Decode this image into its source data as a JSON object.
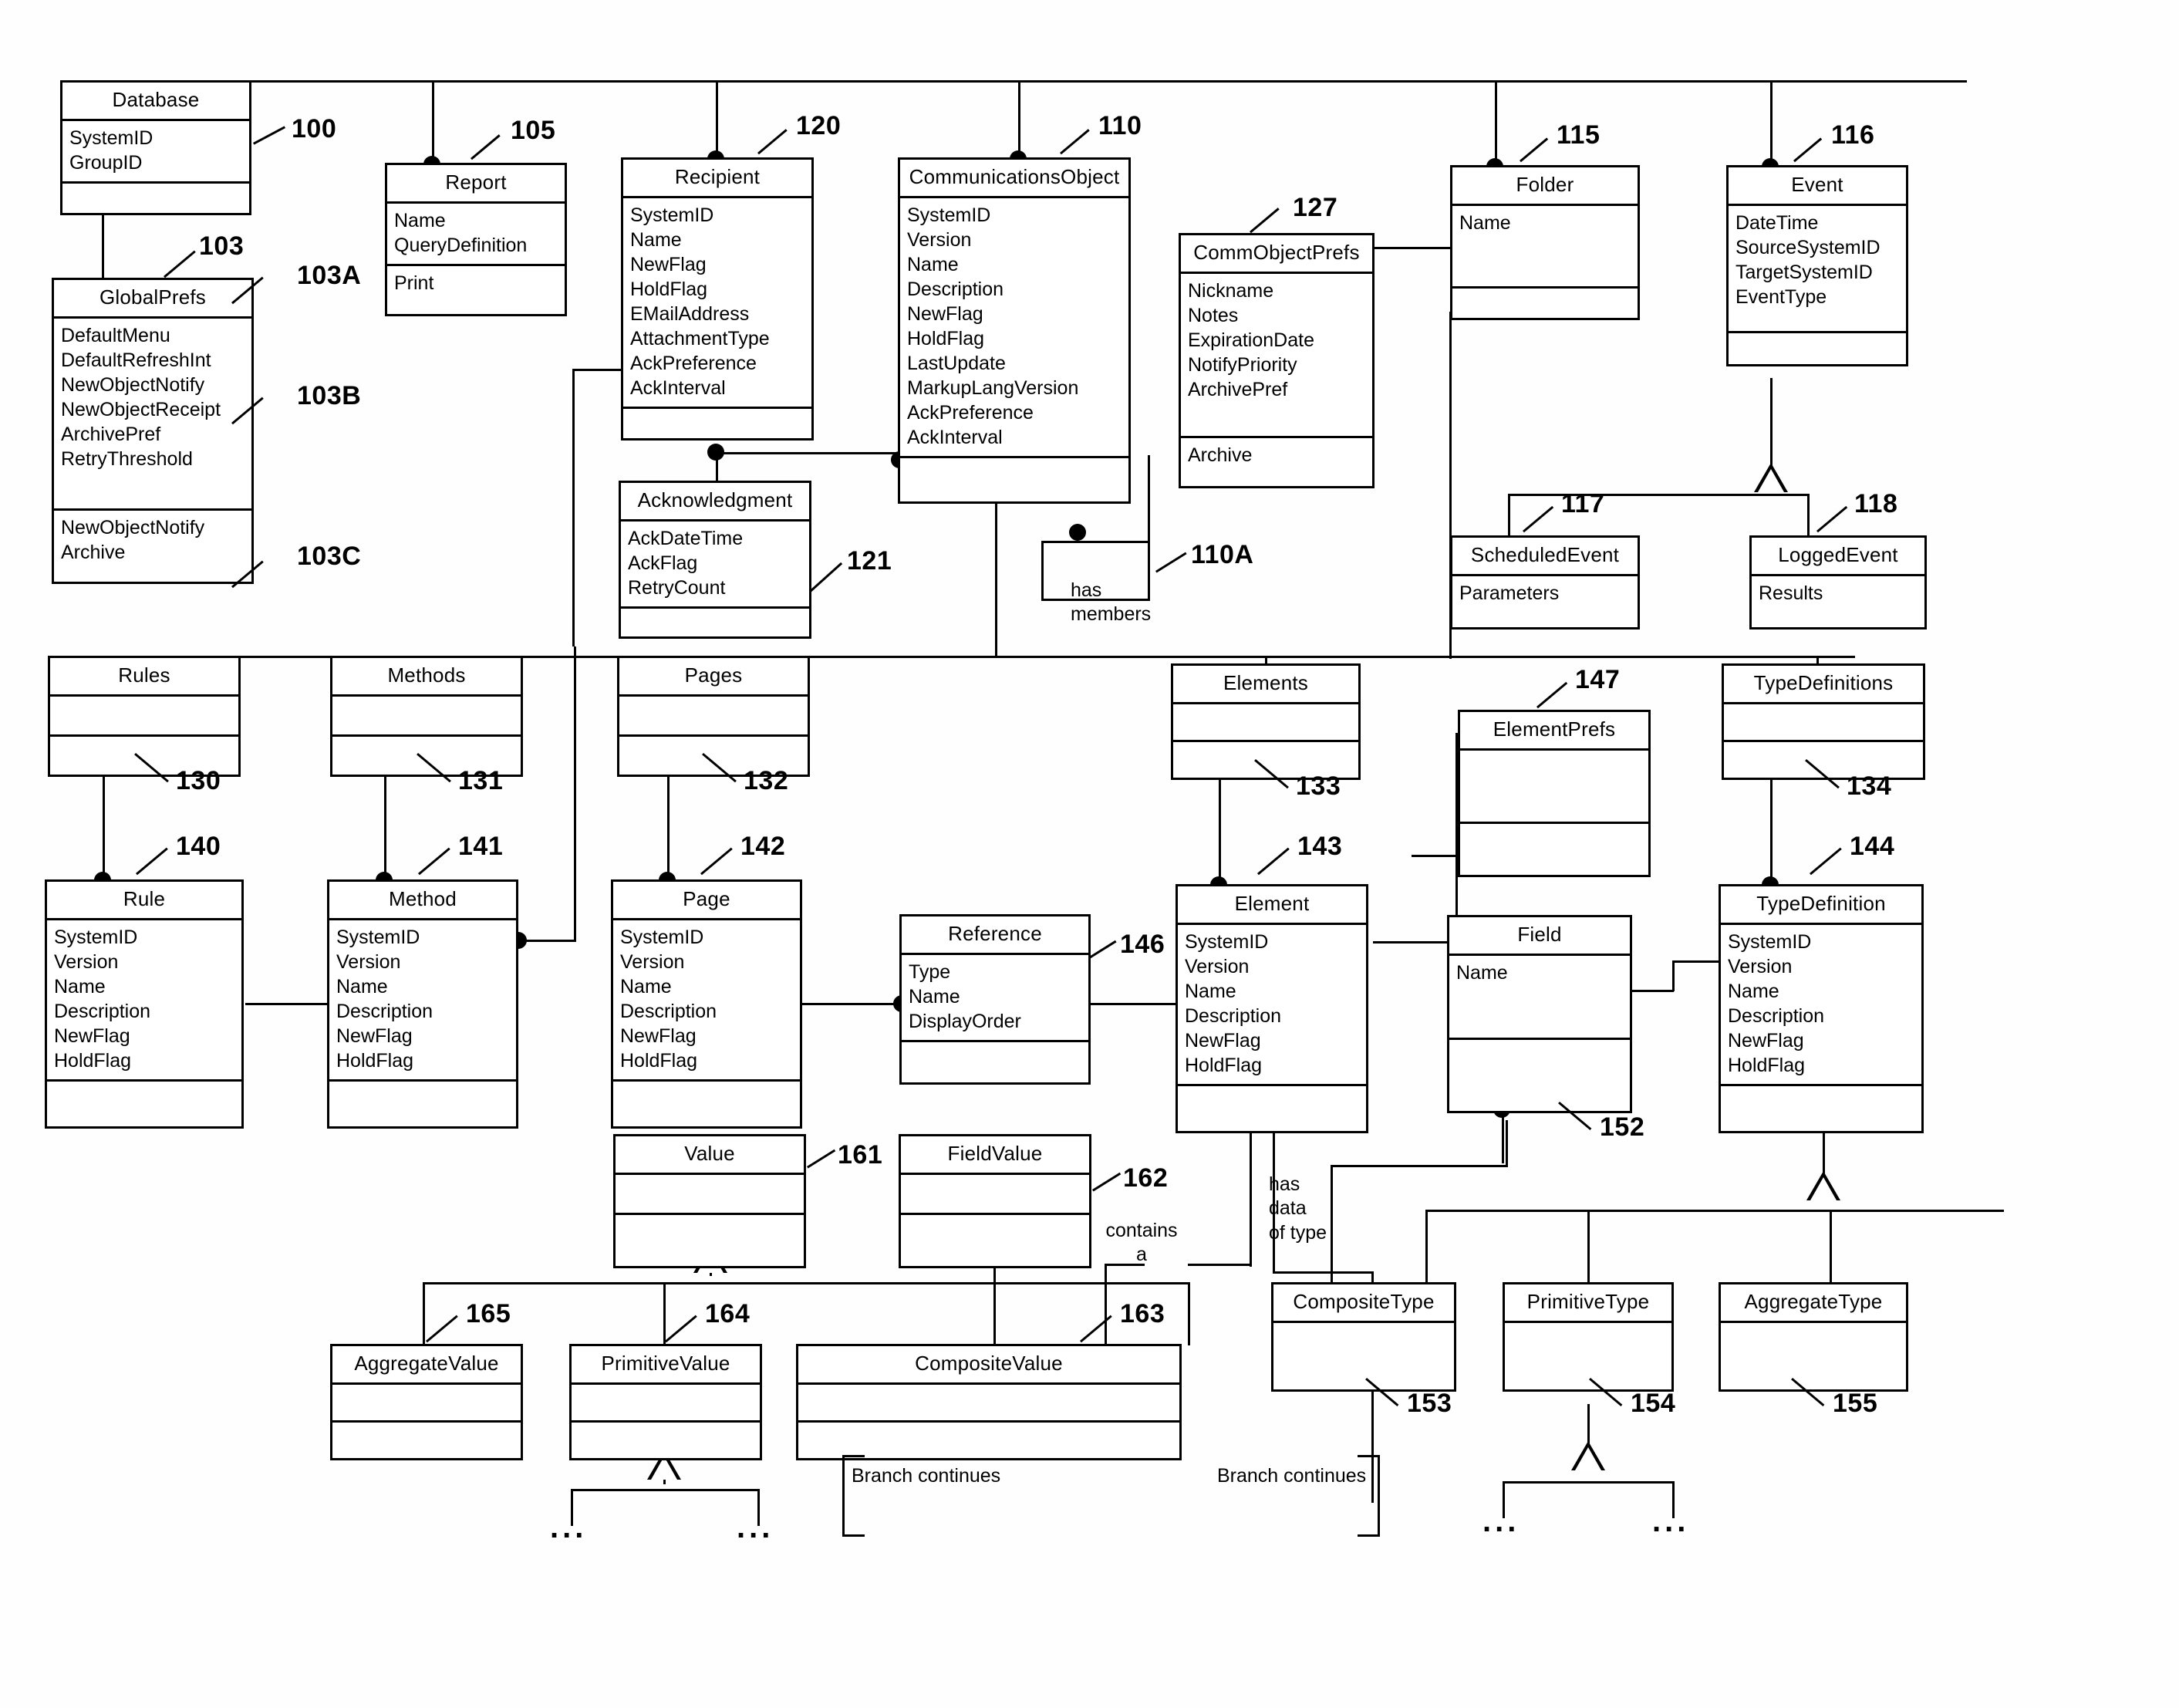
{
  "figure": {
    "type": "uml-class-diagram",
    "classes": [
      {
        "id": "database",
        "name": "Database",
        "ref": "100",
        "attrs": [
          "SystemID",
          "GroupID"
        ],
        "ops": []
      },
      {
        "id": "globalprefs",
        "name": "GlobalPrefs",
        "ref": "103",
        "ref_a": "103A",
        "ref_b": "103B",
        "ref_c": "103C",
        "attrs": [
          "DefaultMenu",
          "DefaultRefreshInt",
          "NewObjectNotify",
          "NewObjectReceipt",
          "ArchivePref",
          "RetryThreshold"
        ],
        "ops": [
          "NewObjectNotify",
          "Archive"
        ]
      },
      {
        "id": "report",
        "name": "Report",
        "ref": "105",
        "attrs": [
          "Name",
          "QueryDefinition"
        ],
        "ops": [
          "Print"
        ]
      },
      {
        "id": "recipient",
        "name": "Recipient",
        "ref": "120",
        "attrs": [
          "SystemID",
          "Name",
          "NewFlag",
          "HoldFlag",
          "EMailAddress",
          "AttachmentType",
          "AckPreference",
          "AckInterval"
        ],
        "ops": []
      },
      {
        "id": "communicationsobject",
        "name": "CommunicationsObject",
        "ref": "110",
        "ref_a": "110A",
        "attrs": [
          "SystemID",
          "Version",
          "Name",
          "Description",
          "NewFlag",
          "HoldFlag",
          "LastUpdate",
          "MarkupLangVersion",
          "AckPreference",
          "AckInterval"
        ],
        "ops": []
      },
      {
        "id": "commobjectprefs",
        "name": "CommObjectPrefs",
        "ref": "127",
        "attrs": [
          "Nickname",
          "Notes",
          "ExpirationDate",
          "NotifyPriority",
          "ArchivePref"
        ],
        "ops": [
          "Archive"
        ]
      },
      {
        "id": "folder",
        "name": "Folder",
        "ref": "115",
        "attrs": [
          "Name"
        ],
        "ops": []
      },
      {
        "id": "event",
        "name": "Event",
        "ref": "116",
        "attrs": [
          "DateTime",
          "SourceSystemID",
          "TargetSystemID",
          "EventType"
        ],
        "ops": []
      },
      {
        "id": "scheduledevent",
        "name": "ScheduledEvent",
        "ref": "117",
        "attrs": [
          "Parameters"
        ],
        "ops": []
      },
      {
        "id": "loggedevent",
        "name": "LoggedEvent",
        "ref": "118",
        "attrs": [
          "Results"
        ],
        "ops": []
      },
      {
        "id": "acknowledgment",
        "name": "Acknowledgment",
        "ref": "121",
        "attrs": [
          "AckDateTime",
          "AckFlag",
          "RetryCount"
        ],
        "ops": []
      },
      {
        "id": "rules",
        "name": "Rules",
        "ref": "130",
        "attrs": [],
        "ops": []
      },
      {
        "id": "methods",
        "name": "Methods",
        "ref": "131",
        "attrs": [],
        "ops": []
      },
      {
        "id": "pages",
        "name": "Pages",
        "ref": "132",
        "attrs": [],
        "ops": []
      },
      {
        "id": "elements",
        "name": "Elements",
        "ref": "133",
        "attrs": [],
        "ops": []
      },
      {
        "id": "elementprefs",
        "name": "ElementPrefs",
        "ref": "147",
        "attrs": [],
        "ops": []
      },
      {
        "id": "typedefinitions",
        "name": "TypeDefinitions",
        "ref": "134",
        "attrs": [],
        "ops": []
      },
      {
        "id": "rule",
        "name": "Rule",
        "ref": "140",
        "attrs": [
          "SystemID",
          "Version",
          "Name",
          "Description",
          "NewFlag",
          "HoldFlag"
        ],
        "ops": []
      },
      {
        "id": "method",
        "name": "Method",
        "ref": "141",
        "attrs": [
          "SystemID",
          "Version",
          "Name",
          "Description",
          "NewFlag",
          "HoldFlag"
        ],
        "ops": []
      },
      {
        "id": "page",
        "name": "Page",
        "ref": "142",
        "attrs": [
          "SystemID",
          "Version",
          "Name",
          "Description",
          "NewFlag",
          "HoldFlag"
        ],
        "ops": []
      },
      {
        "id": "reference",
        "name": "Reference",
        "ref": "146",
        "attrs": [
          "Type",
          "Name",
          "DisplayOrder"
        ],
        "ops": []
      },
      {
        "id": "element",
        "name": "Element",
        "ref": "143",
        "attrs": [
          "SystemID",
          "Version",
          "Name",
          "Description",
          "NewFlag",
          "HoldFlag"
        ],
        "ops": []
      },
      {
        "id": "field",
        "name": "Field",
        "ref": "152",
        "attrs": [
          "Name"
        ],
        "ops": []
      },
      {
        "id": "typedefinition",
        "name": "TypeDefinition",
        "ref": "144",
        "attrs": [
          "SystemID",
          "Version",
          "Name",
          "Description",
          "NewFlag",
          "HoldFlag"
        ],
        "ops": []
      },
      {
        "id": "value",
        "name": "Value",
        "ref": "161",
        "attrs": [],
        "ops": []
      },
      {
        "id": "fieldvalue",
        "name": "FieldValue",
        "ref": "162",
        "attrs": [],
        "ops": []
      },
      {
        "id": "aggregatevalue",
        "name": "AggregateValue",
        "ref": "165",
        "attrs": [],
        "ops": []
      },
      {
        "id": "primitivevalue",
        "name": "PrimitiveValue",
        "ref": "164",
        "attrs": [],
        "ops": []
      },
      {
        "id": "compositevalue",
        "name": "CompositeValue",
        "ref": "163",
        "attrs": [],
        "ops": []
      },
      {
        "id": "compositetype",
        "name": "CompositeType",
        "ref": "153",
        "attrs": [],
        "ops": []
      },
      {
        "id": "primitivetype",
        "name": "PrimitiveType",
        "ref": "154",
        "attrs": [],
        "ops": []
      },
      {
        "id": "aggregatetype",
        "name": "AggregateType",
        "ref": "155",
        "attrs": [],
        "ops": []
      }
    ],
    "labels": {
      "has_members_l1": "has",
      "has_members_l2": "members",
      "has_data_l1": "has",
      "has_data_l2": "data",
      "has_data_l3": "of type",
      "contains_l1": "contains",
      "contains_l2": "a",
      "branch_continues_left": "Branch continues",
      "branch_continues_right": "Branch continues",
      "ellipsis_1": "...",
      "ellipsis_2": "...",
      "ellipsis_3": "...",
      "ellipsis_4": "..."
    }
  }
}
